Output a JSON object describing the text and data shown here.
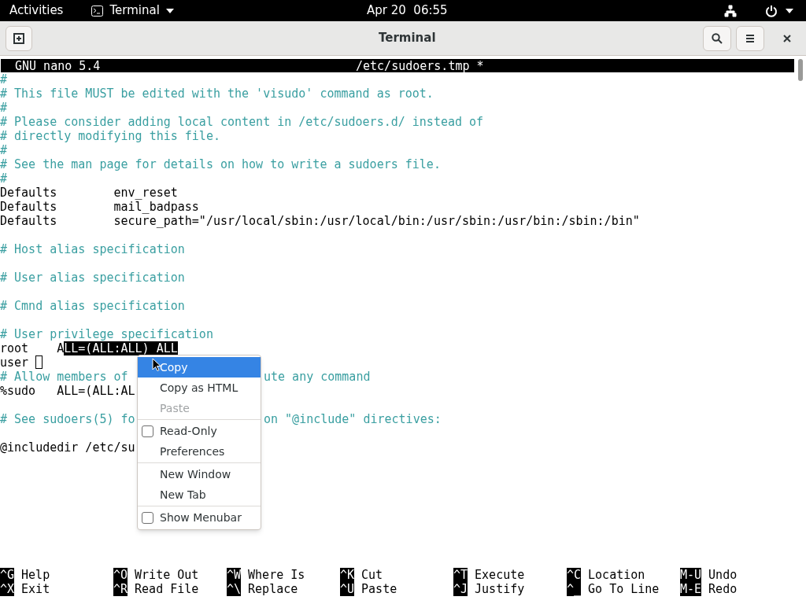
{
  "top_bar": {
    "activities": "Activities",
    "app_menu": "Terminal",
    "clock": "Apr 20  06:55"
  },
  "window": {
    "title": "Terminal"
  },
  "nano": {
    "version": "GNU nano 5.4",
    "file": "/etc/sudoers.tmp *"
  },
  "lines": [
    {
      "kind": "comment",
      "text": "#"
    },
    {
      "kind": "comment",
      "text": "# This file MUST be edited with the 'visudo' command as root."
    },
    {
      "kind": "comment",
      "text": "#"
    },
    {
      "kind": "comment",
      "text": "# Please consider adding local content in /etc/sudoers.d/ instead of"
    },
    {
      "kind": "comment",
      "text": "# directly modifying this file."
    },
    {
      "kind": "comment",
      "text": "#"
    },
    {
      "kind": "comment",
      "text": "# See the man page for details on how to write a sudoers file."
    },
    {
      "kind": "comment",
      "text": "#"
    },
    {
      "kind": "plain",
      "text": "Defaults        env_reset"
    },
    {
      "kind": "plain",
      "text": "Defaults        mail_badpass"
    },
    {
      "kind": "plain",
      "text": "Defaults        secure_path=\"/usr/local/sbin:/usr/local/bin:/usr/sbin:/usr/bin:/sbin:/bin\""
    },
    {
      "kind": "blank"
    },
    {
      "kind": "comment",
      "text": "# Host alias specification"
    },
    {
      "kind": "blank"
    },
    {
      "kind": "comment",
      "text": "# User alias specification"
    },
    {
      "kind": "blank"
    },
    {
      "kind": "comment",
      "text": "# Cmnd alias specification"
    },
    {
      "kind": "blank"
    },
    {
      "kind": "comment",
      "text": "# User privilege specification"
    },
    {
      "kind": "plain",
      "text": "root    A",
      "selection": "LL=(ALL:ALL) ALL"
    },
    {
      "kind": "plain",
      "text": "user ",
      "cursor": true
    },
    {
      "kind": "comment",
      "text": "# Allow members of",
      "tail": "ute any command"
    },
    {
      "kind": "plain",
      "text": "%sudo   ALL=(ALL:AL"
    },
    {
      "kind": "blank"
    },
    {
      "kind": "comment",
      "text": "# See sudoers(5) fo",
      "tail": "on \"@include\" directives:"
    },
    {
      "kind": "blank"
    },
    {
      "kind": "plain",
      "text": "@includedir /etc/su"
    }
  ],
  "shortcuts": [
    {
      "key": "^G",
      "label": "Help"
    },
    {
      "key": "^O",
      "label": "Write Out"
    },
    {
      "key": "^W",
      "label": "Where Is"
    },
    {
      "key": "^K",
      "label": "Cut"
    },
    {
      "key": "^T",
      "label": "Execute"
    },
    {
      "key": "^C",
      "label": "Location"
    },
    {
      "key": "M-U",
      "label": "Undo"
    },
    {
      "key": "^X",
      "label": "Exit"
    },
    {
      "key": "^R",
      "label": "Read File"
    },
    {
      "key": "^\\",
      "label": "Replace"
    },
    {
      "key": "^U",
      "label": "Paste"
    },
    {
      "key": "^J",
      "label": "Justify"
    },
    {
      "key": "^_",
      "label": "Go To Line"
    },
    {
      "key": "M-E",
      "label": "Redo"
    }
  ],
  "context_menu": [
    {
      "kind": "item",
      "label": "Copy",
      "highlighted": true,
      "disabled": false
    },
    {
      "kind": "item",
      "label": "Copy as HTML",
      "highlighted": false,
      "disabled": false
    },
    {
      "kind": "item",
      "label": "Paste",
      "highlighted": false,
      "disabled": true
    },
    {
      "kind": "separator"
    },
    {
      "kind": "checkbox",
      "label": "Read-Only",
      "checked": false,
      "highlighted": false,
      "disabled": false
    },
    {
      "kind": "item",
      "label": "Preferences",
      "highlighted": false,
      "disabled": false
    },
    {
      "kind": "separator"
    },
    {
      "kind": "item",
      "label": "New Window",
      "highlighted": false,
      "disabled": false
    },
    {
      "kind": "item",
      "label": "New Tab",
      "highlighted": false,
      "disabled": false
    },
    {
      "kind": "separator"
    },
    {
      "kind": "checkbox",
      "label": "Show Menubar",
      "checked": false,
      "highlighted": false,
      "disabled": false
    }
  ]
}
